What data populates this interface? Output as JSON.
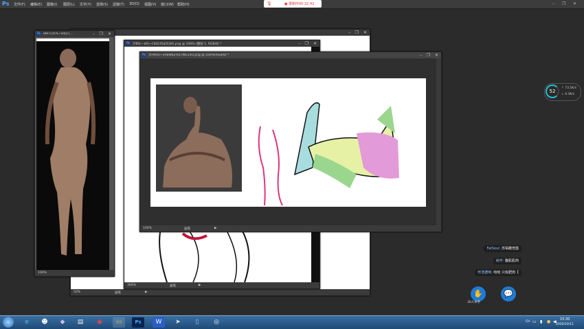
{
  "menubar": {
    "app_logo": "Ps",
    "items": [
      "文件(F)",
      "编辑(E)",
      "图像(I)",
      "图层(L)",
      "文字(Y)",
      "选择(S)",
      "滤镜(T)",
      "3D(D)",
      "视图(V)",
      "窗口(W)",
      "帮助(H)"
    ]
  },
  "recording": {
    "text": "● 录制中00:32:42"
  },
  "windows": {
    "win1": {
      "title": "BWTI[X(%7]4$[F[...",
      "zoom": "100%"
    },
    "win2": {
      "title": "",
      "zoom": "50%",
      "status_label": "画笔"
    },
    "win3": {
      "title": "]YBQ~-$6)~C8G[4S$[S]4G.png @ 100% (图层 1, RGB/8) *",
      "zoom": "300%",
      "status_label": "画笔"
    },
    "win4": {
      "title": "]YFNH5~1R$W$2%5TWE33O.png @ 100%(RGB/8) *",
      "zoom": "100%",
      "status_label": "画笔"
    }
  },
  "hud": {
    "cpu_percent": "52",
    "upload": "73.5K/s",
    "download": "0.3K/s"
  },
  "chat": [
    {
      "user": "FatSoul:",
      "msg": "苏铂撒倍悠"
    },
    {
      "user": "纳字:",
      "msg": "腹肌肌肉"
    },
    {
      "user": "怀浩德咪:",
      "msg": "哈哈 只有肥肉【"
    }
  ],
  "handbtn": {
    "icon": "✋",
    "label": "30人举手"
  },
  "chatbtn": {
    "icon": "💬"
  },
  "taskbar": {
    "tray_lang": "CH",
    "time": "15:30",
    "date": "2020/10/11"
  },
  "colors": {
    "accent": "#1e7bd8",
    "ps_blue": "#4da6ff",
    "taskbar": "#2a5b8c"
  }
}
